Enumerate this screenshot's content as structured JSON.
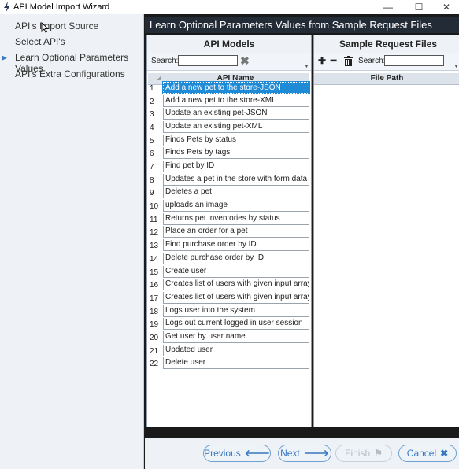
{
  "window": {
    "title": "API Model Import Wizard",
    "minimize": "—",
    "maximize": "☐",
    "close": "✕"
  },
  "steps": [
    {
      "label": "API's Import Source"
    },
    {
      "label": "Select API's"
    },
    {
      "label": "Learn Optional Parameters Values",
      "active": true
    },
    {
      "label": "API's Extra Configurations"
    }
  ],
  "main": {
    "header": "Learn Optional Parameters Values from Sample Request Files"
  },
  "api_models": {
    "title": "API Models",
    "search_label": "Search:",
    "search_value": "",
    "column": "API Name",
    "rows": [
      {
        "n": "1",
        "name": "Add a new pet to the store-JSON"
      },
      {
        "n": "2",
        "name": "Add a new pet to the store-XML"
      },
      {
        "n": "3",
        "name": "Update an existing pet-JSON"
      },
      {
        "n": "4",
        "name": "Update an existing pet-XML"
      },
      {
        "n": "5",
        "name": "Finds Pets by status"
      },
      {
        "n": "6",
        "name": "Finds Pets by tags"
      },
      {
        "n": "7",
        "name": "Find pet by ID"
      },
      {
        "n": "8",
        "name": "Updates a pet in the store with form data"
      },
      {
        "n": "9",
        "name": "Deletes a pet"
      },
      {
        "n": "10",
        "name": "uploads an image"
      },
      {
        "n": "11",
        "name": "Returns pet inventories by status"
      },
      {
        "n": "12",
        "name": "Place an order for a pet"
      },
      {
        "n": "13",
        "name": "Find purchase order by ID"
      },
      {
        "n": "14",
        "name": "Delete purchase order by ID"
      },
      {
        "n": "15",
        "name": "Create user"
      },
      {
        "n": "16",
        "name": "Creates list of users with given input array"
      },
      {
        "n": "17",
        "name": "Creates list of users with given input array"
      },
      {
        "n": "18",
        "name": "Logs user into the system"
      },
      {
        "n": "19",
        "name": "Logs out current logged in user session"
      },
      {
        "n": "20",
        "name": "Get user by user name"
      },
      {
        "n": "21",
        "name": "Updated user"
      },
      {
        "n": "22",
        "name": "Delete user"
      }
    ]
  },
  "sample_files": {
    "title": "Sample Request Files",
    "search_label": "Search:",
    "search_value": "",
    "column": "File Path"
  },
  "footer": {
    "previous": "Previous",
    "next": "Next",
    "finish": "Finish",
    "cancel": "Cancel"
  },
  "colors": {
    "accent": "#3a78c2",
    "selected_row": "#1f8ad6",
    "header_bg": "#232b36"
  }
}
